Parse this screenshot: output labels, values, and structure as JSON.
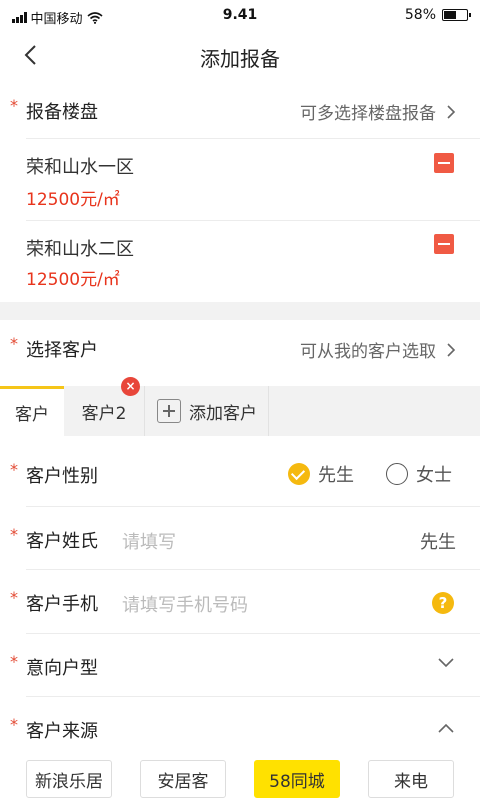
{
  "status_bar": {
    "carrier": "中国移动",
    "time": "9.41",
    "battery": "58%",
    "battery_level": 0.58
  },
  "nav": {
    "title": "添加报备"
  },
  "projects": {
    "label": "报备楼盘",
    "hint": "可多选择楼盘报备",
    "items": [
      {
        "name": "荣和山水一区",
        "price": "12500元/㎡"
      },
      {
        "name": "荣和山水二区",
        "price": "12500元/㎡"
      }
    ]
  },
  "customer_select": {
    "label": "选择客户",
    "hint": "可从我的客户选取"
  },
  "tabs": {
    "items": [
      "客户",
      "客户2"
    ],
    "add_label": "添加客户",
    "close_glyph": "×"
  },
  "gender": {
    "label": "客户性别",
    "options": [
      "先生",
      "女士"
    ],
    "selected": "先生"
  },
  "surname": {
    "label": "客户姓氏",
    "placeholder": "请填写",
    "suffix": "先生"
  },
  "phone": {
    "label": "客户手机",
    "placeholder": "请填写手机号码",
    "help_glyph": "?"
  },
  "house_type": {
    "label": "意向户型"
  },
  "source": {
    "label": "客户来源",
    "options": [
      "新浪乐居",
      "安居客",
      "58同城",
      "来电"
    ],
    "selected": "58同城"
  },
  "required_mark": "*",
  "colors": {
    "accent": "#f5c518",
    "price": "#e8341c",
    "remove": "#f05a44"
  }
}
